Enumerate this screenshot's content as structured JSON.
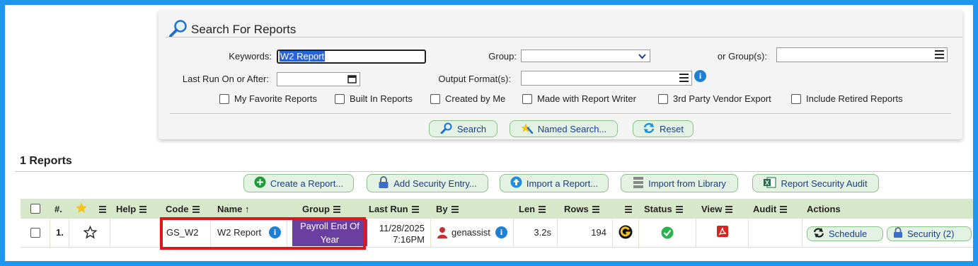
{
  "search": {
    "title": "Search For Reports",
    "keywords_label": "Keywords:",
    "keywords_value": "W2 Report",
    "group_label": "Group:",
    "group_value": "",
    "or_groups_label": "or Group(s):",
    "last_run_label": "Last Run On or After:",
    "output_format_label": "Output Format(s):",
    "checkboxes": [
      "My Favorite Reports",
      "Built In Reports",
      "Created by Me",
      "Made with Report Writer",
      "3rd Party Vendor Export",
      "Include Retired Reports"
    ],
    "buttons": {
      "search": "Search",
      "named_search": "Named Search...",
      "reset": "Reset"
    }
  },
  "results": {
    "title": "1 Reports",
    "toolbar": {
      "create": "Create a Report...",
      "add_security": "Add Security Entry...",
      "import": "Import a Report...",
      "import_library": "Import from Library",
      "security_audit": "Report Security Audit"
    },
    "columns": {
      "num": "#.",
      "help": "Help",
      "code": "Code",
      "name": "Name",
      "group": "Group",
      "last_run": "Last Run",
      "by": "By",
      "len": "Len",
      "rows": "Rows",
      "status": "Status",
      "view": "View",
      "audit": "Audit",
      "actions": "Actions",
      "sort_arrow": "↑"
    },
    "row": {
      "num": "1.",
      "code": "GS_W2",
      "name": "W2 Report",
      "group": "Payroll End Of Year",
      "last_run_date": "11/28/2025",
      "last_run_time": "7:16PM",
      "by": "genassist",
      "len": "3.2s",
      "rows": "194",
      "schedule": "Schedule",
      "security": "Security (2)"
    }
  },
  "colors": {
    "frame": "#1e96f0",
    "button_bg": "#e4f2e4",
    "header_bg": "#d6e8c9",
    "group_bg": "#6b3fa0",
    "highlight": "#e0161d"
  }
}
